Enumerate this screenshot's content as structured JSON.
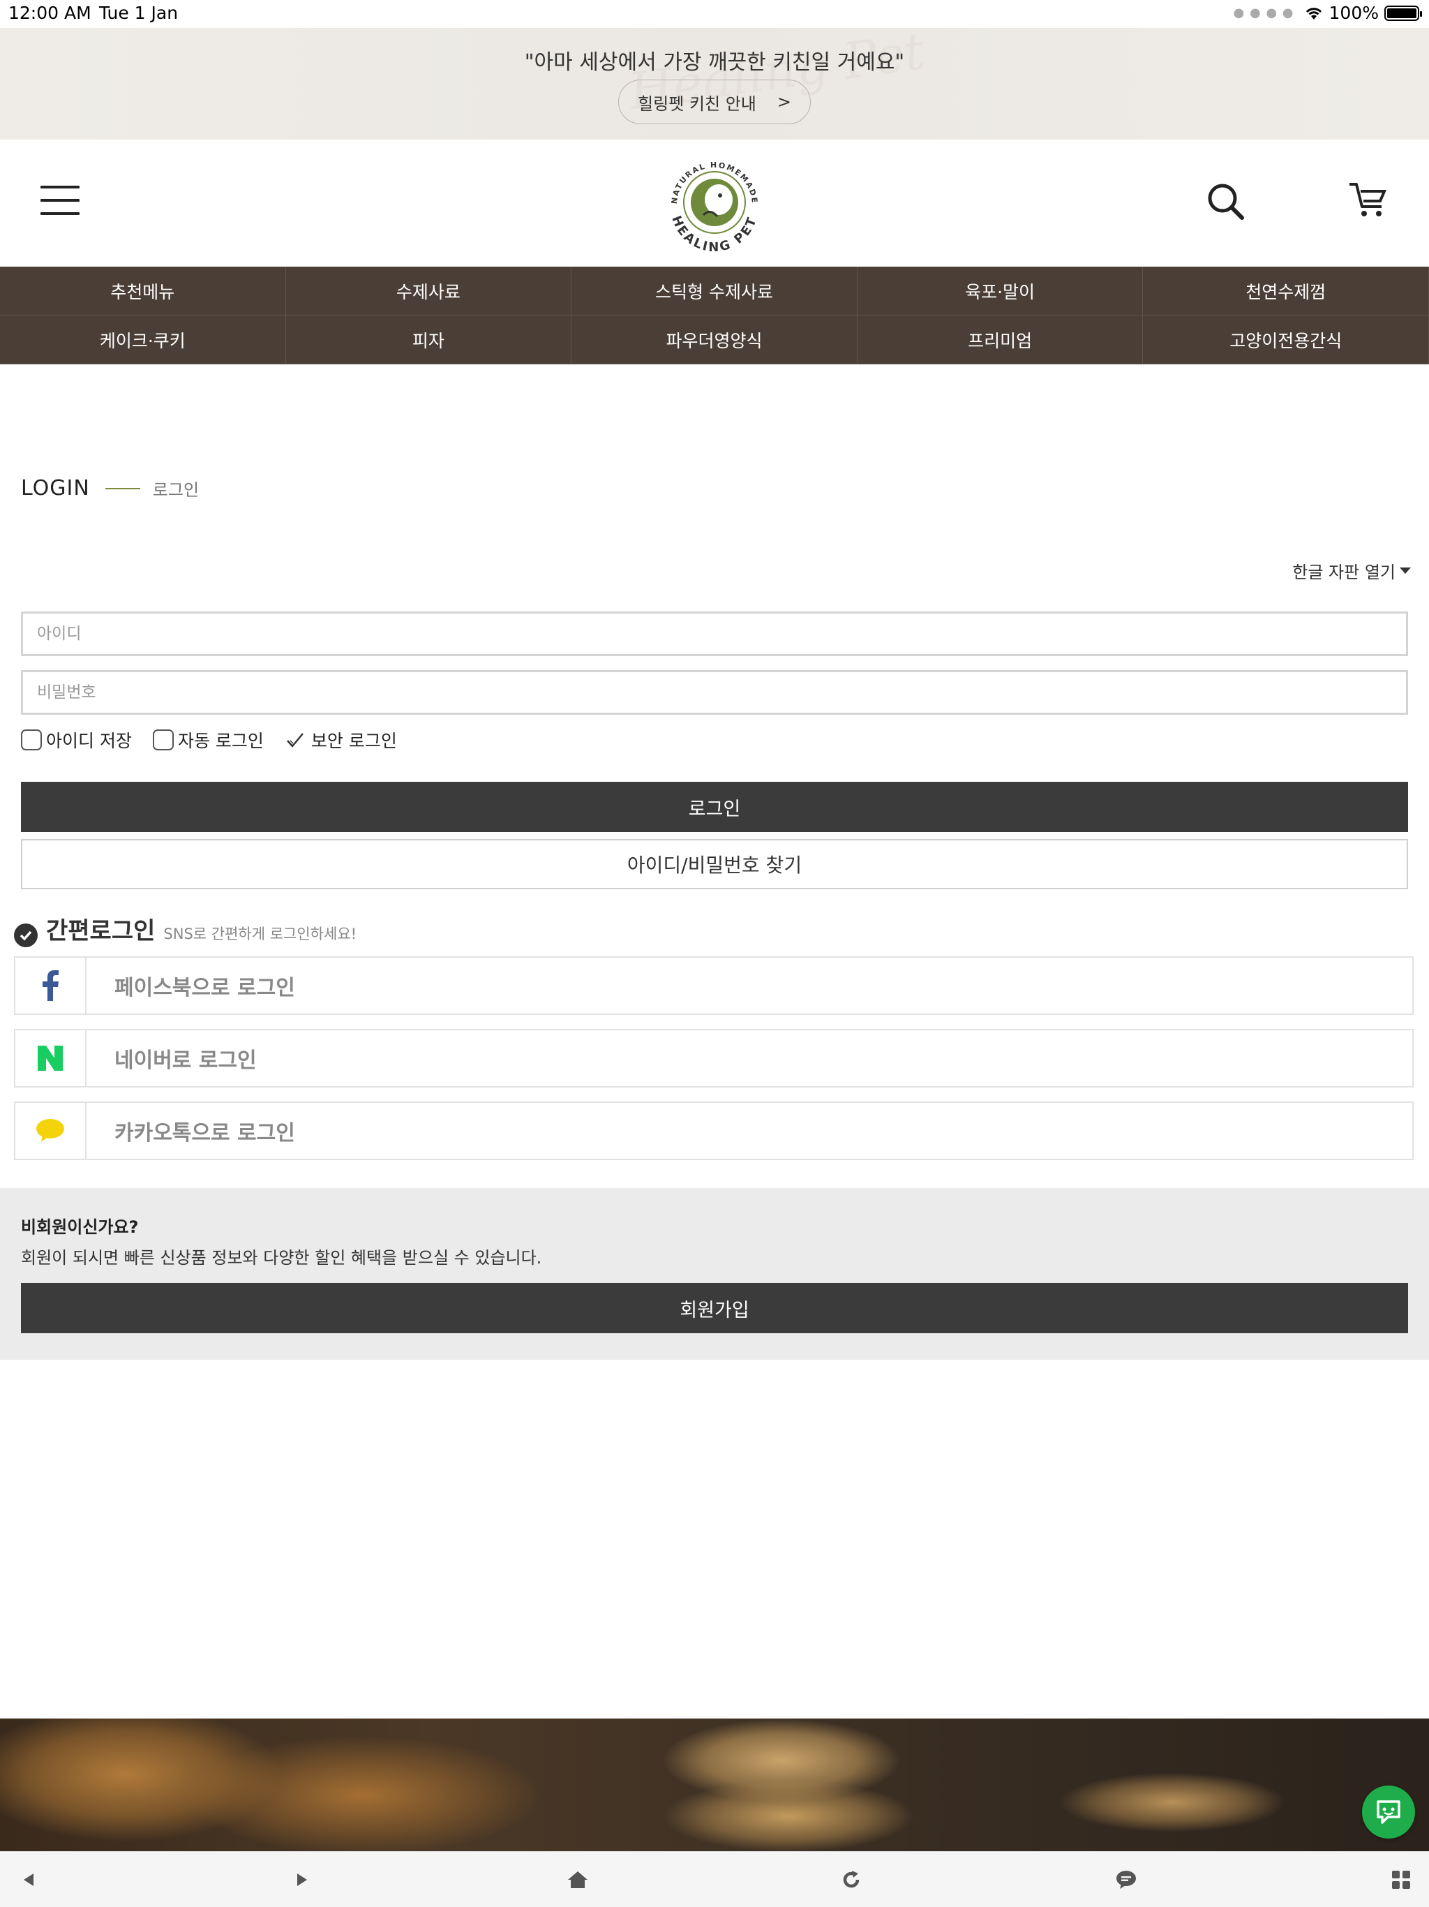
{
  "status_bar": {
    "time": "12:00 AM",
    "date": "Tue 1 Jan",
    "battery": "100%",
    "battery_level": 1.0
  },
  "banner": {
    "quote": "\"아마 세상에서 가장 깨끗한 키친일 거예요\"",
    "guide_label": "힐링펫 키친 안내",
    "guide_arrow": ">",
    "watermark": "Healing Pet"
  },
  "header": {
    "logo_top": "NATURAL HOMEMADE",
    "logo_bottom": "HEALING PET"
  },
  "categories": [
    {
      "label": "추천메뉴"
    },
    {
      "label": "수제사료"
    },
    {
      "label": "스틱형 수제사료"
    },
    {
      "label": "육포·말이"
    },
    {
      "label": "천연수제껌"
    },
    {
      "label": "케이크·쿠키"
    },
    {
      "label": "피자"
    },
    {
      "label": "파우더영양식"
    },
    {
      "label": "프리미엄"
    },
    {
      "label": "고양이전용간식"
    }
  ],
  "login": {
    "title_en": "LOGIN",
    "title_ko": "로그인",
    "keyboard_toggle": "한글 자판 열기",
    "id_placeholder": "아이디",
    "pw_placeholder": "비밀번호",
    "save_id": "아이디 저장",
    "auto_login": "자동 로그인",
    "secure_login": "보안 로그인",
    "login_button": "로그인",
    "find_button": "아이디/비밀번호 찾기"
  },
  "sns": {
    "title": "간편로그인",
    "subtitle": "SNS로 간편하게 로그인하세요!",
    "facebook": "페이스북으로 로그인",
    "naver": "네이버로 로그인",
    "kakao": "카카오톡으로 로그인",
    "colors": {
      "facebook": "#3b5998",
      "naver": "#19ce60",
      "kakao": "#f5d30a"
    }
  },
  "guest": {
    "question": "비회원이신가요?",
    "description": "회원이 되시면 빠른 신상품 정보와 다양한 할인 혜택을 받으실 수 있습니다.",
    "join_button": "회원가입"
  },
  "toolbar": {
    "icons": [
      "back-icon",
      "forward-icon",
      "home-icon",
      "refresh-icon",
      "chat-icon",
      "grid-icon"
    ]
  },
  "colors": {
    "nav_bg": "#4a3e37",
    "button_dark": "#3b3b3b",
    "accent_green": "#7b8a3a",
    "chat_fab": "#1ead4a"
  }
}
